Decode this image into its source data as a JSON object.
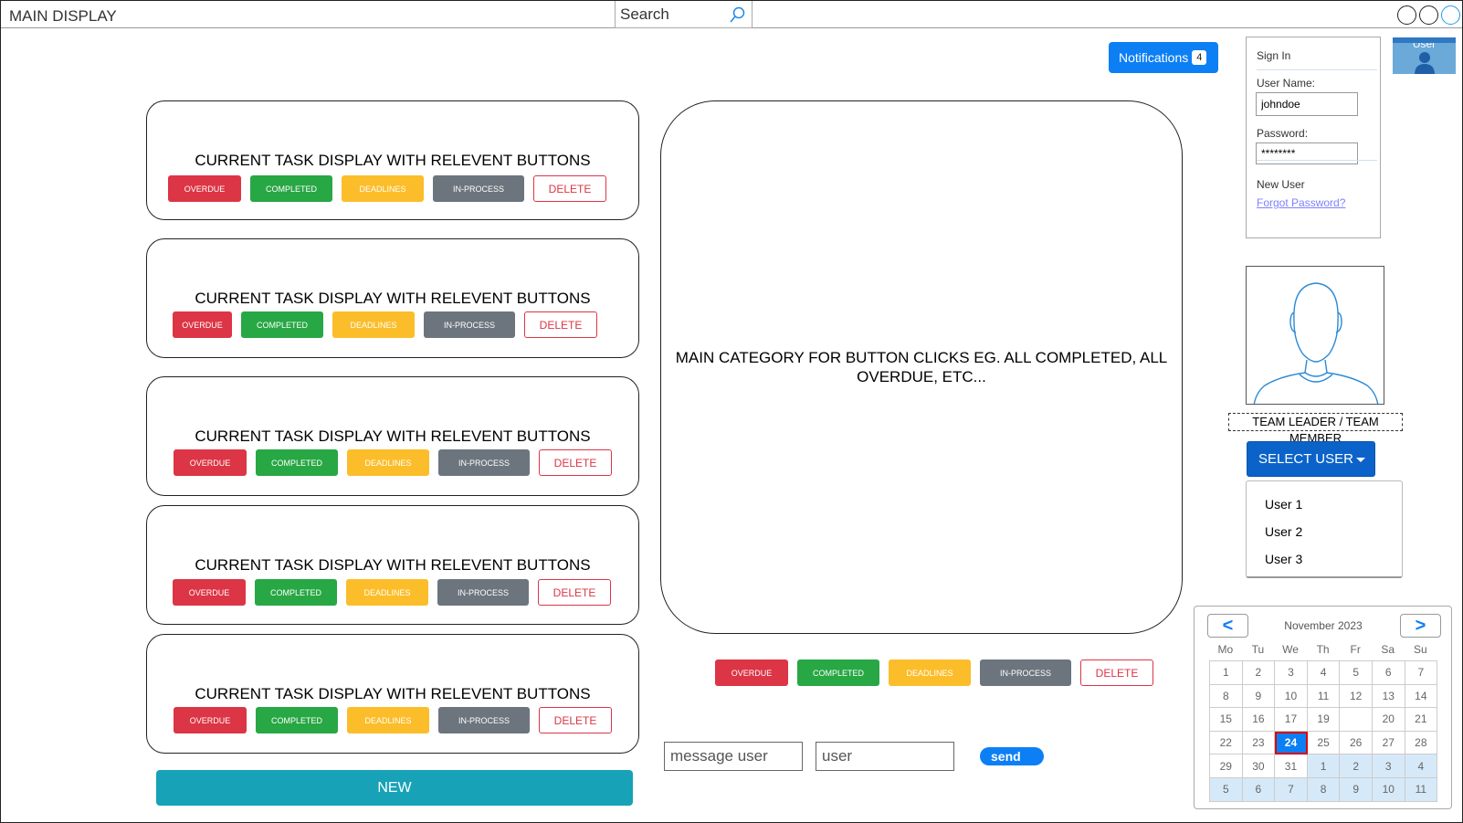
{
  "app": {
    "title": "MAIN DISPLAY"
  },
  "search": {
    "placeholder": "Search",
    "icon": "search-icon"
  },
  "notifications": {
    "label": "Notifications",
    "count": "4"
  },
  "signin": {
    "header": "Sign In",
    "username_label": "User Name:",
    "username_value": "johndoe",
    "password_label": "Password:",
    "password_value": "********",
    "new_user": "New User",
    "forgot": "Forgot Password?"
  },
  "user_tile": {
    "label": "User"
  },
  "profile": {
    "role": "TEAM LEADER / TEAM MEMBER"
  },
  "select_user": {
    "label": "SELECT USER",
    "options": [
      "User 1",
      "User 2",
      "User 3"
    ]
  },
  "tasks": [
    {
      "title": "CURRENT TASK DISPLAY WITH RELEVENT BUTTONS"
    },
    {
      "title": "CURRENT TASK DISPLAY WITH RELEVENT BUTTONS"
    },
    {
      "title": "CURRENT TASK DISPLAY WITH RELEVENT BUTTONS"
    },
    {
      "title": "CURRENT TASK DISPLAY WITH RELEVENT BUTTONS"
    },
    {
      "title": "CURRENT TASK DISPLAY WITH RELEVENT BUTTONS"
    }
  ],
  "task_buttons": {
    "overdue": "OVERDUE",
    "completed": "COMPLETED",
    "deadlines": "DEADLINES",
    "in_process": "IN-PROCESS",
    "delete": "DELETE"
  },
  "new_button": "NEW",
  "main": {
    "text": "MAIN CATEGORY FOR BUTTON CLICKS EG. ALL COMPLETED, ALL OVERDUE, ETC..."
  },
  "message": {
    "message_placeholder": "message user",
    "user_placeholder": "user",
    "send_label": "send"
  },
  "calendar": {
    "month": "November 2023",
    "prev": "<",
    "next": ">",
    "weekdays": [
      "Mo",
      "Tu",
      "We",
      "Th",
      "Fr",
      "Sa",
      "Su"
    ],
    "days": [
      "1",
      "2",
      "3",
      "4",
      "5",
      "6",
      "7",
      "8",
      "9",
      "10",
      "11",
      "12",
      "13",
      "14",
      "15",
      "16",
      "17",
      "19",
      "",
      "20",
      "21",
      "22",
      "23",
      "24",
      "25",
      "26",
      "27",
      "28",
      "29",
      "30",
      "31",
      "1",
      "2",
      "3",
      "4",
      "5",
      "6",
      "7",
      "8",
      "9",
      "10",
      "11"
    ],
    "selected": "24"
  },
  "colors": {
    "overdue": "#dc3545",
    "completed": "#28a745",
    "deadlines": "#fbbd2a",
    "in_process": "#6c757d",
    "primary": "#0d7ff5",
    "new": "#17a2b8"
  }
}
